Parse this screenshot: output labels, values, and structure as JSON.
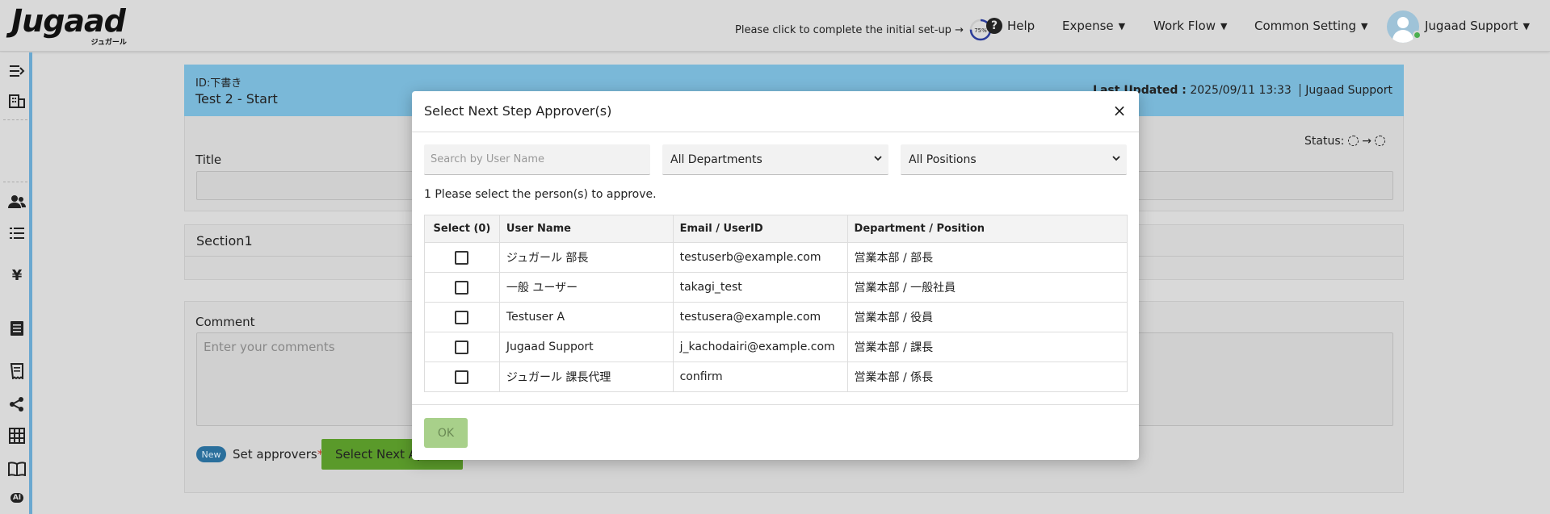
{
  "header": {
    "logo_text": "Jugaad",
    "logo_sub": "ジュガール",
    "setup_text": "Please click to complete the initial set-up →",
    "setup_progress": 75,
    "setup_progress_label": "75%",
    "help_label": "Help",
    "nav": [
      "Expense",
      "Work Flow",
      "Common Setting"
    ],
    "user_name": "Jugaad Support"
  },
  "sidebar": {
    "icons": [
      "expand-icon",
      "building-icon",
      "users-icon",
      "list-icon",
      "yen-icon",
      "document-icon",
      "receipt-icon",
      "share-icon",
      "grid-icon",
      "book-icon",
      "ai-icon"
    ],
    "ai_label": "AI"
  },
  "form": {
    "id_label": "ID:下書き",
    "name": "Test 2 - Start",
    "last_updated_label": "Last Updated :",
    "last_updated_value": "2025/09/11 13:33",
    "last_updated_user": "Jugaad Support",
    "status_label": "Status:",
    "title_label": "Title",
    "section_label": "Section1",
    "comment_label": "Comment",
    "comment_placeholder": "Enter your comments",
    "new_badge": "New",
    "set_approvers_label": "Set approvers",
    "required_mark": "*",
    "select_next_button": "Select Next Ap"
  },
  "modal": {
    "title": "Select Next Step Approver(s)",
    "close_label": "×",
    "search_placeholder": "Search by User Name",
    "department_filter": "All Departments",
    "position_filter": "All Positions",
    "instruction": "1 Please select the person(s) to approve.",
    "columns": [
      "Select (0)",
      "User Name",
      "Email / UserID",
      "Department / Position"
    ],
    "rows": [
      {
        "name": "ジュガール 部長",
        "email": "testuserb@example.com",
        "dept": "営業本部 / 部長"
      },
      {
        "name": "一般 ユーザー",
        "email": "takagi_test",
        "dept": "営業本部 / 一般社員"
      },
      {
        "name": "Testuser A",
        "email": "testusera@example.com",
        "dept": "営業本部 / 役員"
      },
      {
        "name": "Jugaad Support",
        "email": "j_kachodairi@example.com",
        "dept": "営業本部 / 課長"
      },
      {
        "name": "ジュガール 課長代理",
        "email": "confirm",
        "dept": "営業本部 / 係長"
      }
    ],
    "ok_label": "OK"
  },
  "colors": {
    "form_header": "#7ab8d8",
    "primary_button": "#5a9a2a",
    "ok_disabled": "#a8d08a",
    "badge": "#2a6f9c",
    "online": "#4caf50"
  }
}
